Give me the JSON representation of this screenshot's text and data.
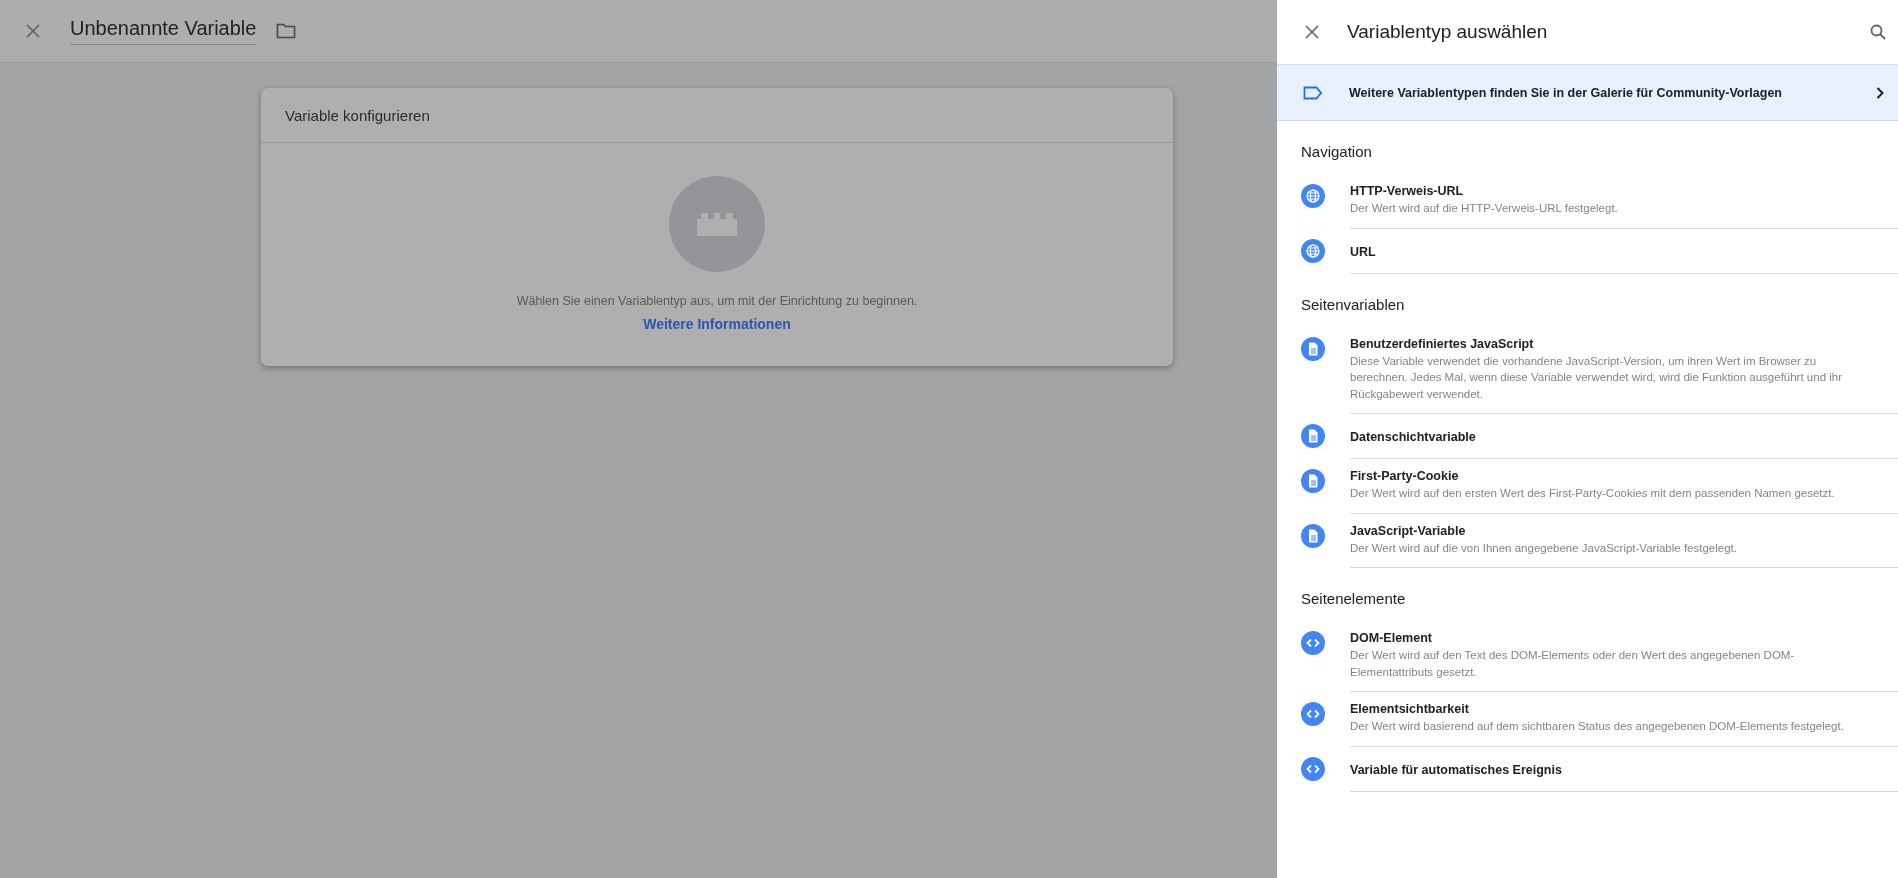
{
  "editor": {
    "title": "Unbenannte Variable"
  },
  "card": {
    "title": "Variable konfigurieren",
    "message": "Wählen Sie einen Variablentyp aus, um mit der Einrichtung zu beginnen.",
    "link": "Weitere Informationen"
  },
  "panel": {
    "title": "Variablentyp auswählen",
    "banner": "Weitere Variablentypen finden Sie in der Galerie für Community-Vorlagen",
    "sections": [
      {
        "heading": "Navigation",
        "items": [
          {
            "kind": "globe",
            "name": "HTTP-Verweis-URL",
            "description": "Der Wert wird auf die HTTP-Verweis-URL festgelegt."
          },
          {
            "kind": "globe",
            "name": "URL"
          }
        ]
      },
      {
        "heading": "Seitenvariablen",
        "items": [
          {
            "kind": "document",
            "name": "Benutzerdefiniertes JavaScript",
            "description": "Diese Variable verwendet die vorhandene JavaScript-Version, um ihren Wert im Browser zu berechnen. Jedes Mal, wenn diese Variable verwendet wird, wird die Funktion ausgeführt und ihr Rückgabewert verwendet."
          },
          {
            "kind": "document",
            "name": "Datenschichtvariable"
          },
          {
            "kind": "document",
            "name": "First-Party-Cookie",
            "description": "Der Wert wird auf den ersten Wert des First-Party-Cookies mit dem passenden Namen gesetzt."
          },
          {
            "kind": "document",
            "name": "JavaScript-Variable",
            "description": "Der Wert wird auf die von Ihnen angegebene JavaScript-Variable festgelegt."
          }
        ]
      },
      {
        "heading": "Seitenelemente",
        "items": [
          {
            "kind": "code",
            "name": "DOM-Element",
            "description": "Der Wert wird auf den Text des DOM-Elements oder den Wert des angegebenen DOM-Elementattributs gesetzt."
          },
          {
            "kind": "code",
            "name": "Elementsichtbarkeit",
            "description": "Der Wert wird basierend auf dem sichtbaren Status des angegebenen DOM-Elements festgelegt."
          },
          {
            "kind": "code",
            "name": "Variable für automatisches Ereignis"
          }
        ]
      }
    ]
  }
}
